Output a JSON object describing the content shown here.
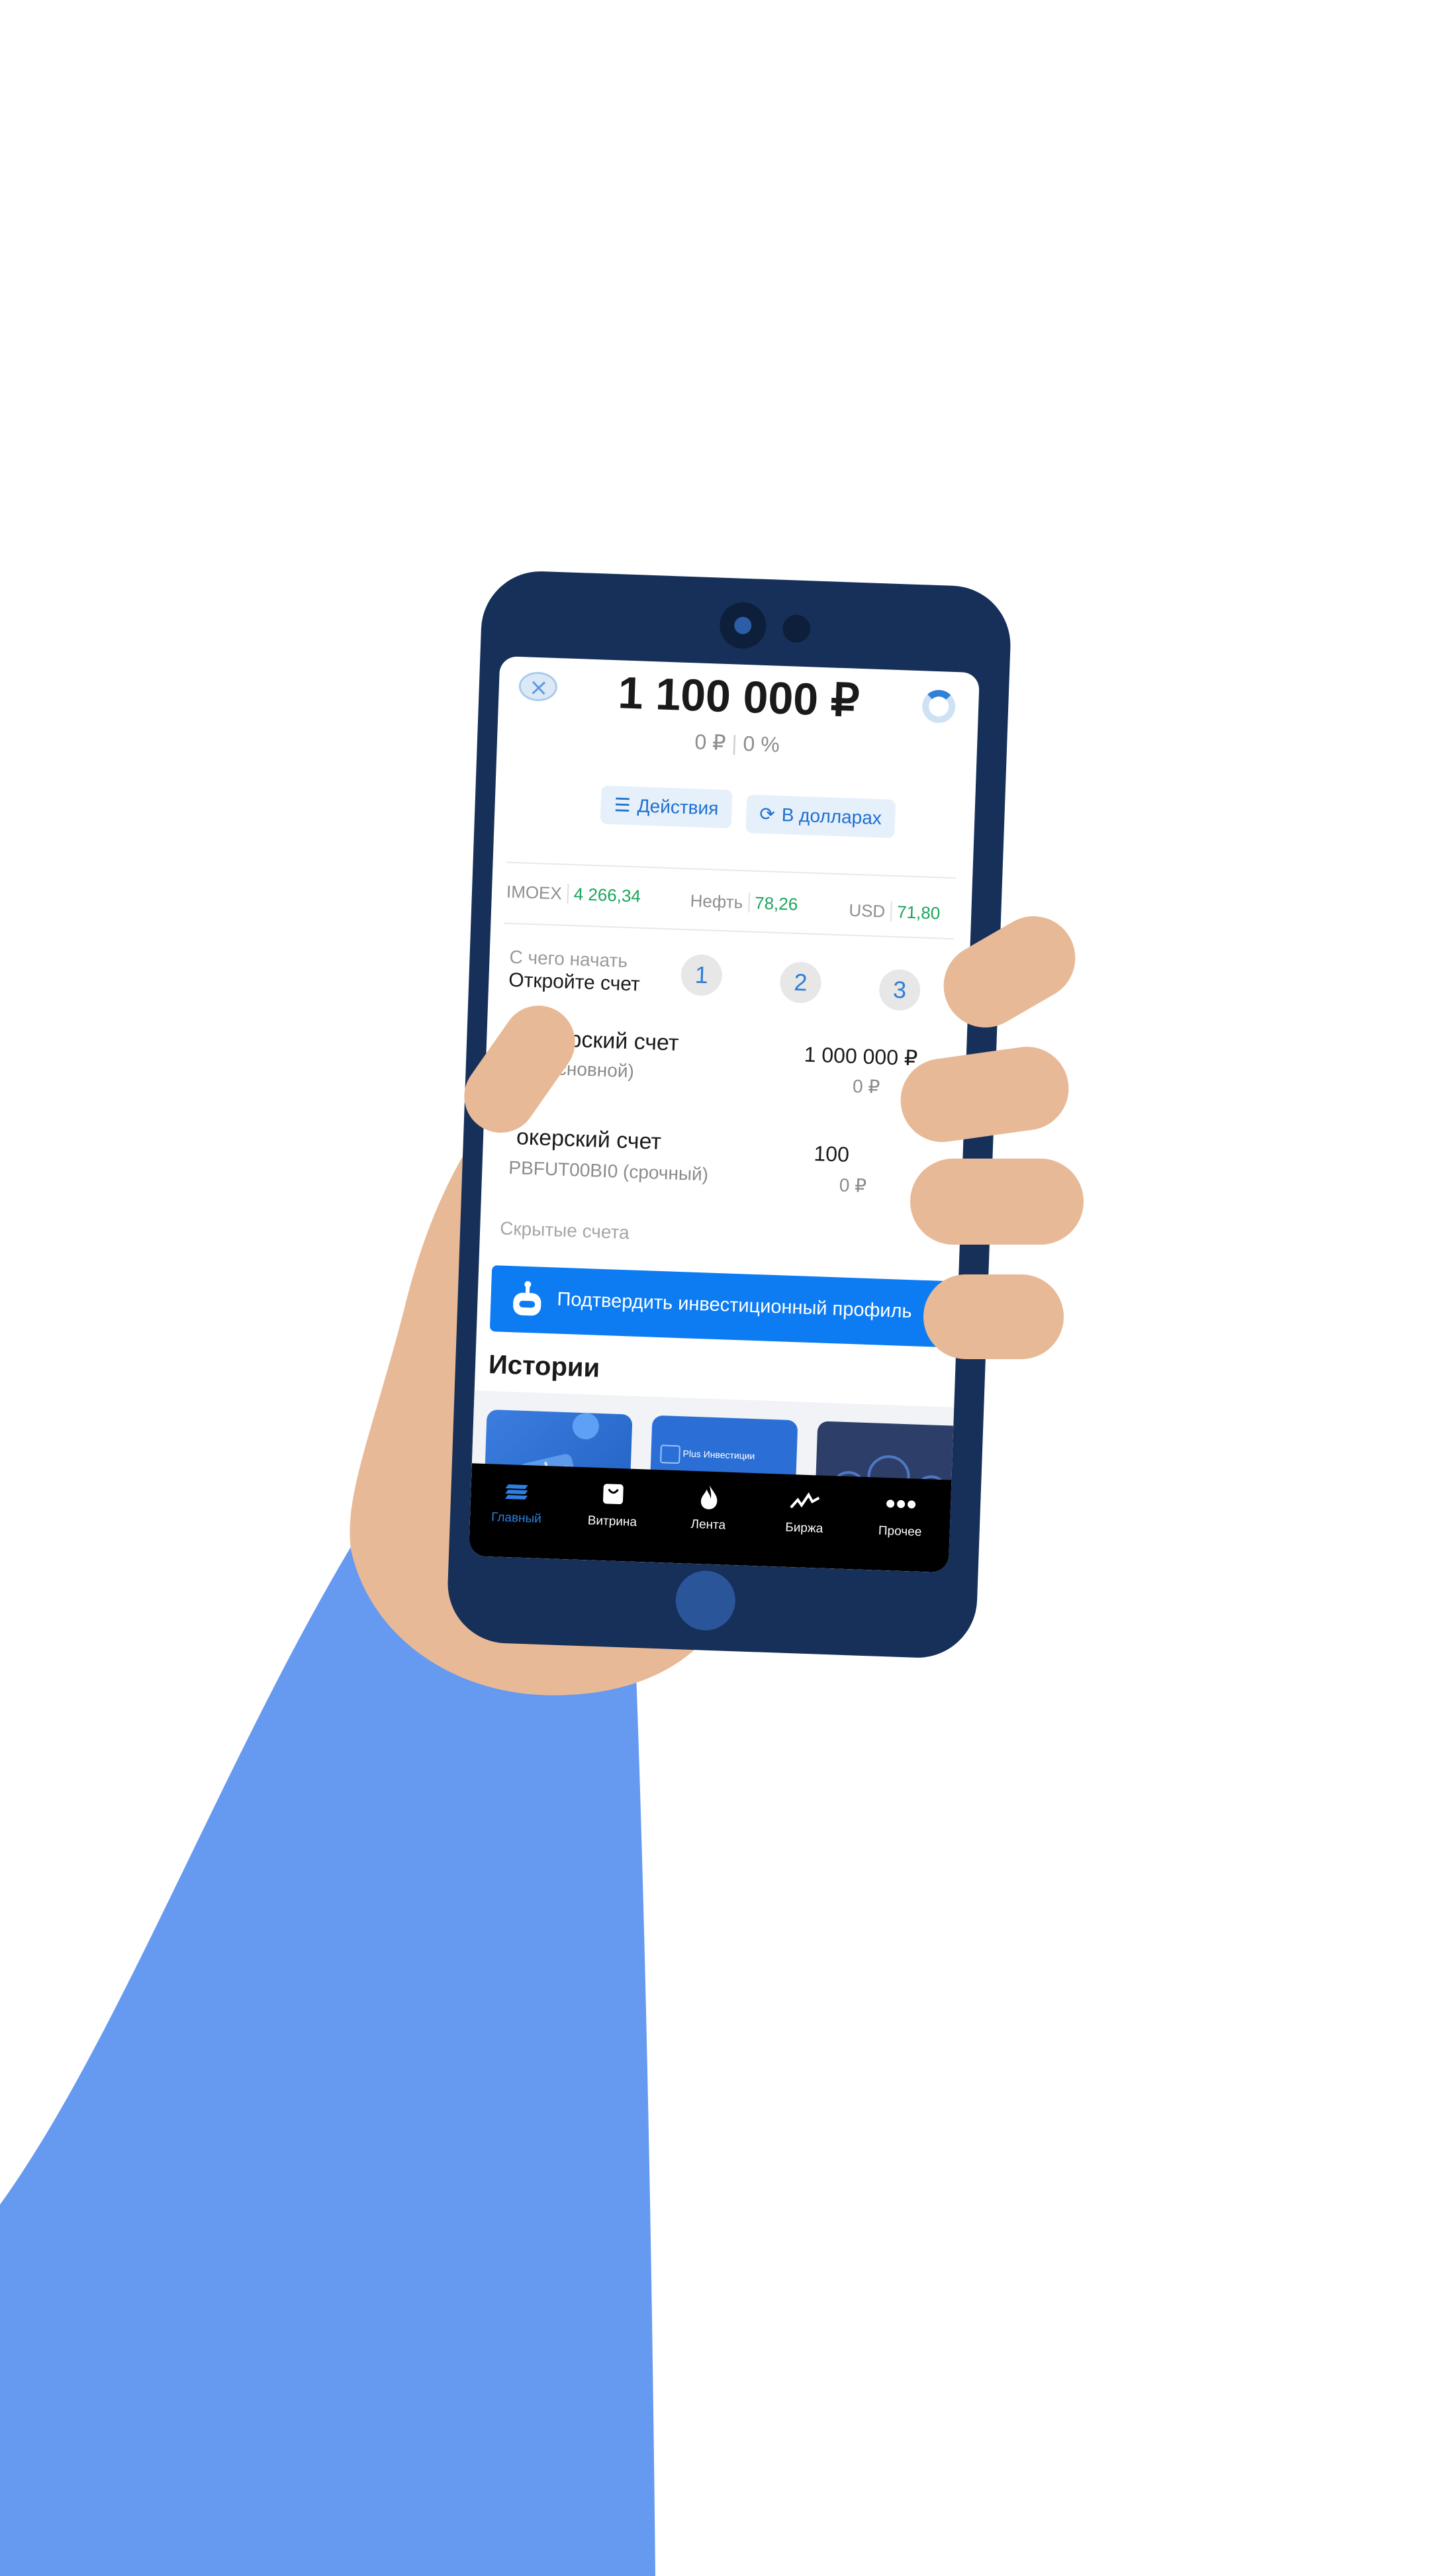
{
  "header": {
    "balance": "1 100 000 ₽",
    "change_amount": "0 ₽",
    "change_percent": "0 %"
  },
  "actions": [
    {
      "label": "Действия",
      "icon": "list-icon"
    },
    {
      "label": "В долларах",
      "icon": "refresh-icon"
    }
  ],
  "tickers": [
    {
      "name": "IMOEX",
      "value": "4 266,34"
    },
    {
      "name": "Нефть",
      "value": "78,26"
    },
    {
      "name": "USD",
      "value": "71,80"
    }
  ],
  "getting_started": {
    "title": "С чего начать",
    "subtitle": "Откройте счет",
    "steps": [
      "1",
      "2",
      "3"
    ]
  },
  "accounts": [
    {
      "title": "Брокерский счет",
      "subtitle": "1 (основной)",
      "amount": "1 000 000 ₽",
      "change": "0 ₽"
    },
    {
      "title": "окерский счет",
      "subtitle": "PBFUT00BI0 (срочный)",
      "amount": "100",
      "change": "0 ₽"
    }
  ],
  "hidden_accounts_label": "Скрытые счета",
  "verify_banner": {
    "text": "Подтвердить инвестиционный профиль",
    "icon": "robot-icon"
  },
  "stories": {
    "title": "Истории",
    "cards": [
      {
        "icon": "gift-icon"
      },
      {
        "label": "Plus Инвестиции",
        "icon": "logo-icon"
      },
      {
        "icon": "characters-icon"
      }
    ]
  },
  "tabs": [
    {
      "label": "Главный",
      "icon": "home-stack-icon",
      "active": true
    },
    {
      "label": "Витрина",
      "icon": "bag-icon",
      "active": false
    },
    {
      "label": "Лента",
      "icon": "flame-icon",
      "active": false
    },
    {
      "label": "Биржа",
      "icon": "chart-line-icon",
      "active": false
    },
    {
      "label": "Прочее",
      "icon": "more-icon",
      "active": false
    }
  ],
  "colors": {
    "accent": "#0d7cf2",
    "positive": "#19a65b",
    "phone_body": "#16305a",
    "sleeve": "#6699f0",
    "skin": "#e8b996"
  }
}
